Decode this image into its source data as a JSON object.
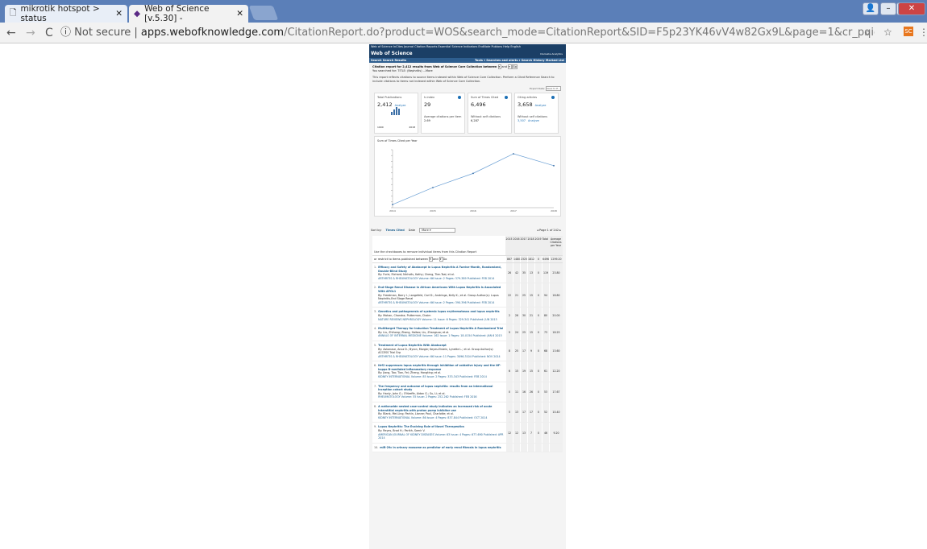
{
  "browser": {
    "tabs": [
      {
        "label": "mikrotik hotspot > status",
        "close": "✕"
      },
      {
        "label": "Web of Science [v.5.30] -",
        "close": "✕"
      }
    ],
    "security_label": "Not secure",
    "url_host": "apps.webofknowledge.com",
    "url_path": "/CitationReport.do?product=WOS&search_mode=CitationReport&SID=F5p23YK46vV4w82Gx9L&page=1&cr_pqid=2&viewType=summary&colName=WOS",
    "ext_label": "SC"
  },
  "wos": {
    "top_nav": "Web of Science   InCites   Journal Citation Reports   Essential Science Indicators   EndNote   Publons   Help   English",
    "brand": "Web of Science",
    "clarivate": "Clarivate Analytics",
    "search_link": "Search",
    "search_results": "Search Results",
    "right_nav": "Tools ▾  Searches and alerts ▾  Search History  Marked List",
    "citation_report_prefix": "Citation report for 2,412 results from Web of Science Core Collection between",
    "year_and": "and",
    "go": "Go",
    "searched_for": "You searched for: TITLE: (Nephritis) ...More",
    "note": "This report reflects citations to source items indexed within Web of Science Core Collection. Perform a Cited Reference Search to include citations to items not indexed within Web of Science Core Collection.",
    "export_label": "Export Data:",
    "export_select": "Save to E...",
    "metrics": {
      "total_pubs_label": "Total Publications",
      "total_pubs": "2,412",
      "analyze": "Analyze",
      "year_from": "1900",
      "year_to": "2018",
      "h_index_label": "h-index",
      "h_index": "29",
      "avg_label": "Average citations per item",
      "avg": "2.69",
      "sum_label": "Sum of Times Cited",
      "sum": "6,496",
      "without_self_label": "Without self citations",
      "without_self": "6,287",
      "citing_label": "Citing articles",
      "citing": "3,658",
      "citing_wo_label": "Without self citations",
      "citing_wo": "3,507"
    },
    "chart_title": "Sum of Times Cited per Year",
    "sort_label": "Sort by:",
    "sort_times_cited": "Times Cited",
    "sort_date": "Date",
    "sort_more": "More",
    "pager": "◂  Page 1   of 242  ▸",
    "checkbox_note": "Use the checkboxes to remove individual items from this Citation Report",
    "restrict_note": "or restrict to items published between",
    "years": [
      "2015",
      "2016",
      "2017",
      "2018",
      "2019",
      "Total",
      "Average Citations per Year"
    ],
    "totals": [
      "867",
      "1480",
      "2325",
      "1812",
      "0",
      "6496",
      "1299.20"
    ],
    "results": [
      {
        "n": "1.",
        "title": "Efficacy and Safety of Abatacept in Lupus Nephritis A Twelve-Month, Randomized, Double-Blind Study",
        "authors": "By: Furie, Richard; Nicholls, Kathy; Cheng, Tien-Tsai; et al.",
        "journal": "ARTHRITIS & RHEUMATOLOGY  Volume: 66  Issue: 2  Pages: 379-389  Published: FEB 2014",
        "c": [
          "26",
          "42",
          "35",
          "13",
          "0",
          "119",
          "23.80"
        ]
      },
      {
        "n": "2.",
        "title": "End-Stage Renal Disease in African Americans With Lupus Nephritis Is Associated With APOL1",
        "authors": "By: Freedman, Barry I.; Langefeld, Carl D.; Andringa, Kelly K.; et al. Group Author(s): Lupus Nephritis-End Stage Renal",
        "journal": "ARTHRITIS & RHEUMATOLOGY  Volume: 66  Issue: 2  Pages: 390-396  Published: FEB 2014",
        "c": [
          "22",
          "21",
          "25",
          "15",
          "0",
          "94",
          "18.80"
        ]
      },
      {
        "n": "3.",
        "title": "Genetics and pathogenesis of systemic lupus erythematosus and lupus nephritis",
        "authors": "By: Mohan, Chandra; Putterman, Chaim",
        "journal": "NATURE REVIEWS NEPHROLOGY  Volume: 11  Issue: 6  Pages: 329-341  Published: JUN 2015",
        "c": [
          "2",
          "26",
          "30",
          "21",
          "0",
          "80",
          "20.00"
        ]
      },
      {
        "n": "4.",
        "title": "Multitarget Therapy for Induction Treatment of Lupus Nephritis A Randomized Trial",
        "authors": "By: Liu, Zhihong; Zhang, Haitao; Liu, Zhangsuo; et al.",
        "journal": "ANNALS OF INTERNAL MEDICINE  Volume: 162  Issue: 1  Pages: 18-U154  Published: JAN 6 2015",
        "c": [
          "9",
          "24",
          "25",
          "15",
          "0",
          "73",
          "18.25"
        ]
      },
      {
        "n": "5.",
        "title": "Treatment of Lupus Nephritis With Abatacept",
        "authors": "By: Askanase, Anca D.; Byron, Margie; Keyes-Elstein, Lynette L.; et al. Group Author(s): ACCESS Trial Grp",
        "journal": "ARTHRITIS & RHEUMATOLOGY  Volume: 66  Issue: 11  Pages: 3096-3104  Published: NOV 2014",
        "c": [
          "8",
          "25",
          "17",
          "9",
          "0",
          "68",
          "13.60"
        ]
      },
      {
        "n": "6.",
        "title": "Nrf2 suppresses lupus nephritis through inhibition of oxidative injury and the NF-kappa B-mediated inflammatory response",
        "authors": "By: Jiang, Tao; Tian, Fei; Zheng, Hongting; et al.",
        "journal": "KIDNEY INTERNATIONAL  Volume: 85  Issue: 2  Pages: 333-343  Published: FEB 2014",
        "c": [
          "6",
          "15",
          "19",
          "15",
          "0",
          "61",
          "12.20"
        ]
      },
      {
        "n": "7.",
        "title": "The frequency and outcome of lupus nephritis: results from an international inception cohort study",
        "authors": "By: Hanly, John G.; O'Keeffe, Aidan G.; Su, Li; et al.",
        "journal": "RHEUMATOLOGY  Volume: 55  Issue: 2  Pages: 252-262  Published: FEB 2016",
        "c": [
          "0",
          "11",
          "16",
          "26",
          "0",
          "53",
          "17.67"
        ]
      },
      {
        "n": "8.",
        "title": "A nationwide nested case-control study indicates an increased risk of acute interstitial nephritis with proton pump inhibitor use",
        "authors": "By: Blank, Mei-Ling; Parkin, Lianne; Paul, Charlotte; et al.",
        "journal": "KIDNEY INTERNATIONAL  Volume: 86  Issue: 4  Pages: 837-844  Published: OCT 2014",
        "c": [
          "5",
          "13",
          "17",
          "17",
          "0",
          "52",
          "10.40"
        ]
      },
      {
        "n": "9.",
        "title": "Lupus Nephritis: The Evolving Role of Novel Therapeutics",
        "authors": "By: Reyes, Brad H.; Parikh, Samir V.",
        "journal": "AMERICAN JOURNAL OF KIDNEY DISEASES  Volume: 63  Issue: 4  Pages: 677-690  Published: APR 2014",
        "c": [
          "12",
          "12",
          "13",
          "7",
          "0",
          "46",
          "9.20"
        ]
      },
      {
        "n": "10.",
        "title": "miR-29c in urinary exosome as predictor of early renal fibrosis in lupus nephritis",
        "authors": "",
        "journal": "",
        "c": [
          "",
          "",
          "",
          "",
          "",
          "",
          ""
        ]
      }
    ]
  },
  "chart_data": {
    "type": "line",
    "title": "Sum of Times Cited per Year",
    "x": [
      "2014",
      "2015",
      "2016",
      "2017",
      "2018"
    ],
    "values": [
      135,
      867,
      1480,
      2325,
      1812
    ],
    "ylim": [
      0,
      2500
    ],
    "grid": false
  }
}
